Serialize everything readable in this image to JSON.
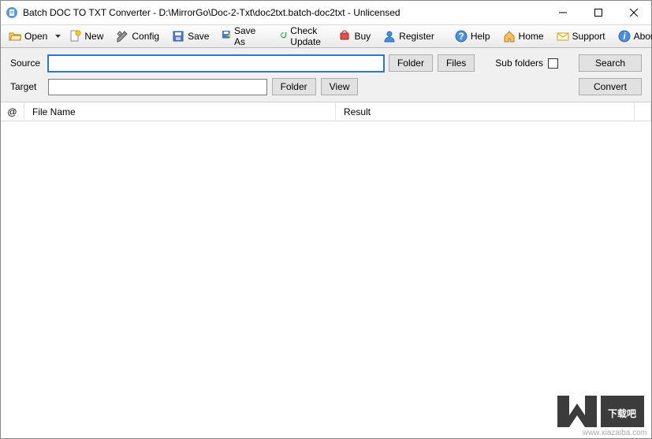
{
  "title": "Batch DOC TO TXT Converter - D:\\MirrorGo\\Doc-2-Txt\\doc2txt.batch-doc2txt - Unlicensed",
  "toolbar": {
    "open": "Open",
    "new": "New",
    "config": "Config",
    "save": "Save",
    "saveas": "Save As",
    "check": "Check Update",
    "buy": "Buy",
    "register": "Register",
    "help": "Help",
    "home": "Home",
    "support": "Support",
    "about": "About"
  },
  "panel": {
    "sourceLabel": "Source",
    "targetLabel": "Target",
    "sourceValue": "",
    "targetValue": "",
    "folder": "Folder",
    "files": "Files",
    "view": "View",
    "subfolders": "Sub folders",
    "search": "Search",
    "convert": "Convert"
  },
  "columns": {
    "at": "@",
    "filename": "File Name",
    "result": "Result"
  },
  "watermark": {
    "cn": "下载吧",
    "url": "www.xiazaiba.com"
  }
}
